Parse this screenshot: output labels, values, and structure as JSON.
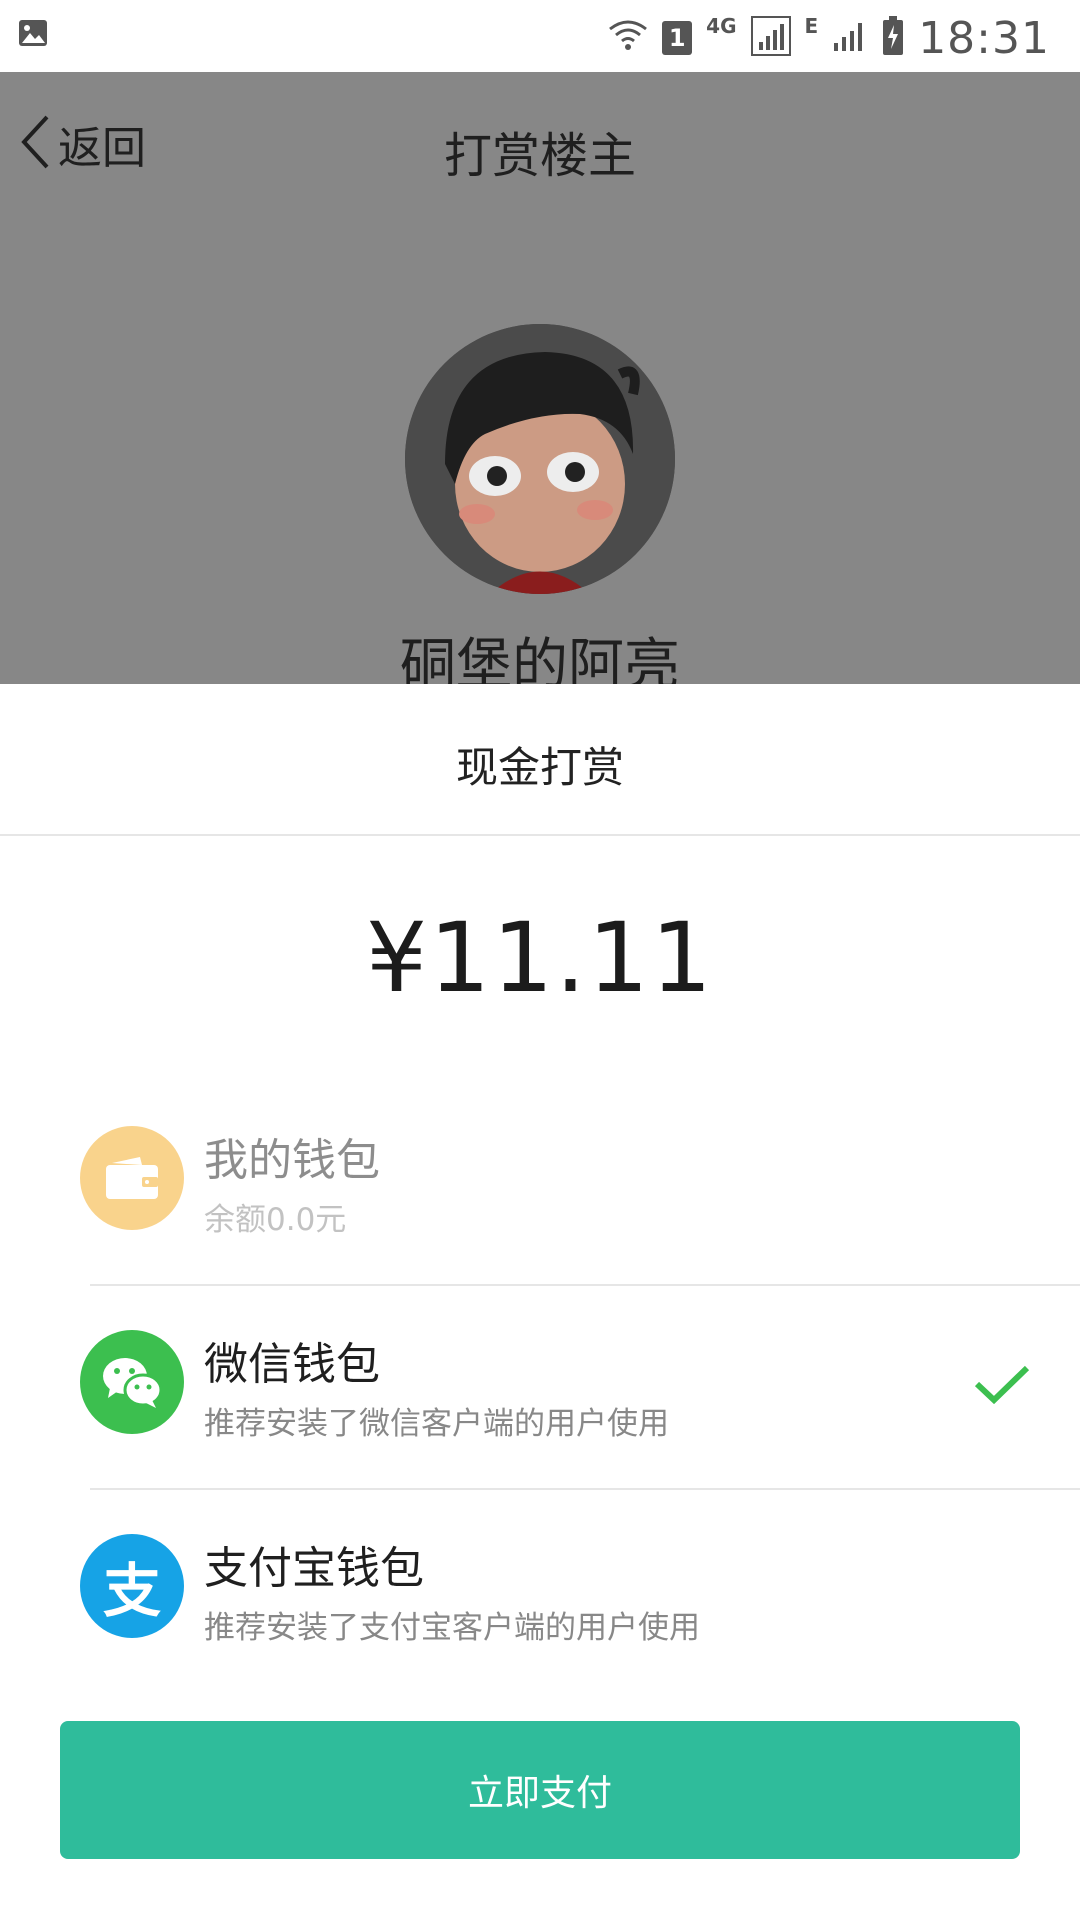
{
  "status_bar": {
    "sim_badge": "1",
    "network_4g": "4G",
    "network_e": "E",
    "time": "18:31"
  },
  "header": {
    "back_label": "返回",
    "title": "打赏楼主"
  },
  "profile": {
    "username": "硐堡的阿亮"
  },
  "sheet": {
    "title": "现金打赏",
    "amount": "¥11.11",
    "options": [
      {
        "name": "我的钱包",
        "desc": "余额0.0元",
        "icon": "wallet-icon",
        "color": "#f9d38c",
        "enabled": false,
        "selected": false
      },
      {
        "name": "微信钱包",
        "desc": "推荐安装了微信客户端的用户使用",
        "icon": "wechat-icon",
        "color": "#3cbf4f",
        "enabled": true,
        "selected": true
      },
      {
        "name": "支付宝钱包",
        "desc": "推荐安装了支付宝客户端的用户使用",
        "icon": "alipay-icon",
        "color": "#16a3e6",
        "enabled": true,
        "selected": false
      }
    ],
    "alipay_glyph": "支",
    "pay_button": "立即支付",
    "accent_color": "#2fbc9b",
    "check_color": "#3cbf4f"
  }
}
